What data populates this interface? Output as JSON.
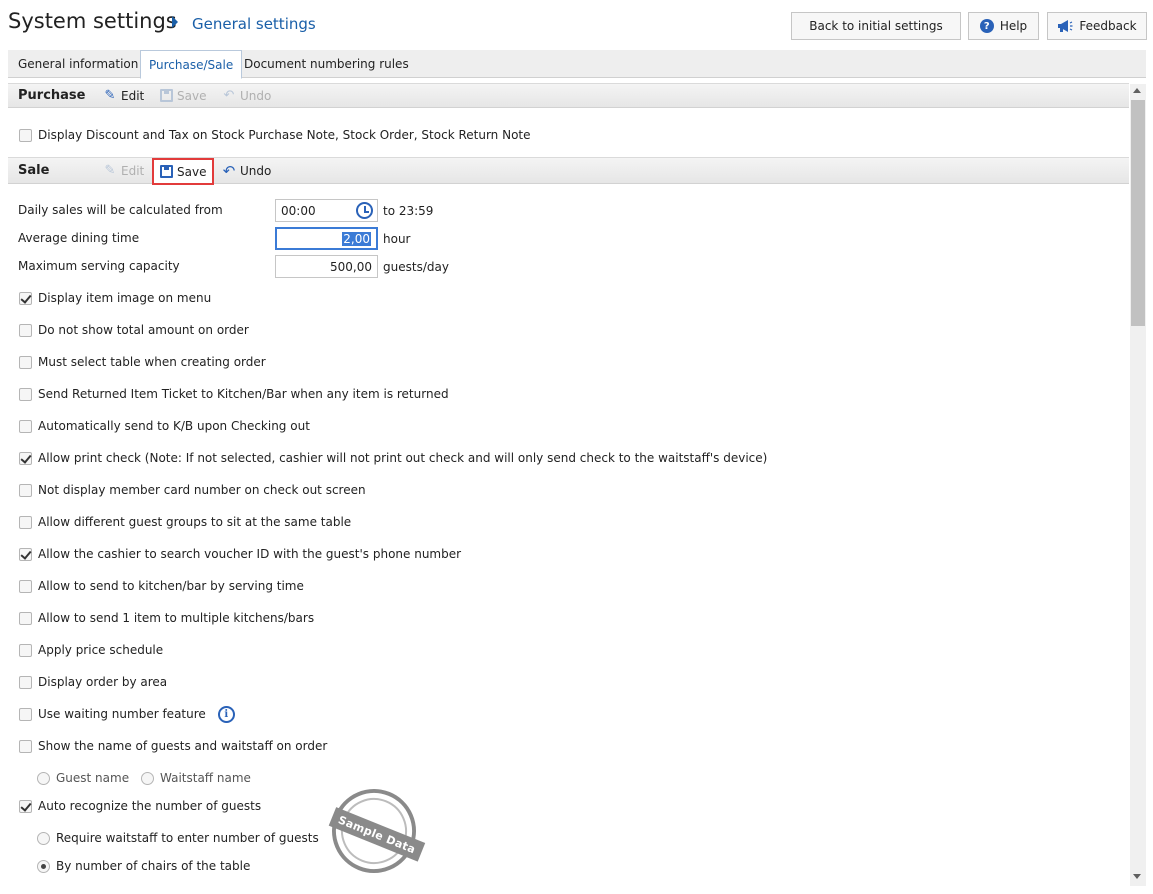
{
  "header": {
    "title": "System settings",
    "breadcrumb": "General settings",
    "back_button": "Back to initial settings",
    "help_button": "Help",
    "feedback_button": "Feedback"
  },
  "tabs": [
    {
      "label": "General information",
      "active": false
    },
    {
      "label": "Purchase/Sale",
      "active": true
    },
    {
      "label": "Document numbering rules",
      "active": false
    }
  ],
  "purchase": {
    "title": "Purchase",
    "edit": "Edit",
    "save": "Save",
    "undo": "Undo",
    "options": [
      {
        "label": "Display Discount and Tax on Stock Purchase Note, Stock Order, Stock Return Note",
        "checked": false
      }
    ]
  },
  "sale": {
    "title": "Sale",
    "edit": "Edit",
    "save": "Save",
    "undo": "Undo",
    "fields": {
      "daily_sales_label": "Daily sales will be calculated from",
      "daily_sales_from": "00:00",
      "daily_sales_to": "to 23:59",
      "avg_dining_label": "Average dining time",
      "avg_dining_value": "2,00",
      "avg_dining_unit": "hour",
      "max_capacity_label": "Maximum serving capacity",
      "max_capacity_value": "500,00",
      "max_capacity_unit": "guests/day"
    },
    "options": [
      {
        "label": "Display item image on menu",
        "checked": true
      },
      {
        "label": "Do not show total amount on order",
        "checked": false
      },
      {
        "label": "Must select table when creating order",
        "checked": false
      },
      {
        "label": "Send Returned Item Ticket to Kitchen/Bar when any item is returned",
        "checked": false
      },
      {
        "label": "Automatically send to K/B upon Checking out",
        "checked": false
      },
      {
        "label": "Allow print check (Note: If not selected, cashier will not print out check and will only send check to the waitstaff's device)",
        "checked": true
      },
      {
        "label": "Not display member card number on check out screen",
        "checked": false
      },
      {
        "label": "Allow different guest groups to sit at the same table",
        "checked": false
      },
      {
        "label": "Allow the cashier to search voucher ID with the guest's phone number",
        "checked": true
      },
      {
        "label": "Allow to send to kitchen/bar by serving time",
        "checked": false
      },
      {
        "label": "Allow to send 1 item to multiple kitchens/bars",
        "checked": false
      },
      {
        "label": "Apply price schedule",
        "checked": false
      },
      {
        "label": "Display order by area",
        "checked": false
      },
      {
        "label": "Use waiting number feature",
        "checked": false
      },
      {
        "label": "Show the name of guests and waitstaff on order",
        "checked": false
      },
      {
        "label": "Auto recognize the number of guests",
        "checked": true
      }
    ],
    "name_radios": [
      {
        "label": "Guest name",
        "selected": false
      },
      {
        "label": "Waitstaff name",
        "selected": false
      }
    ],
    "guest_radios": [
      {
        "label": "Require waitstaff to enter number of guests",
        "selected": false
      },
      {
        "label": "By number of chairs of the table",
        "selected": true
      }
    ]
  },
  "watermark": "Sample Data",
  "icons": {
    "edit": "edit-icon",
    "save": "save-icon",
    "undo": "undo-icon",
    "help": "help-icon",
    "feedback": "megaphone-icon",
    "clock": "clock-reset-icon",
    "info": "info-icon"
  },
  "colors": {
    "accent": "#1a5fa8",
    "highlight_border": "#e23b3b",
    "selection": "#3b7bd6"
  }
}
